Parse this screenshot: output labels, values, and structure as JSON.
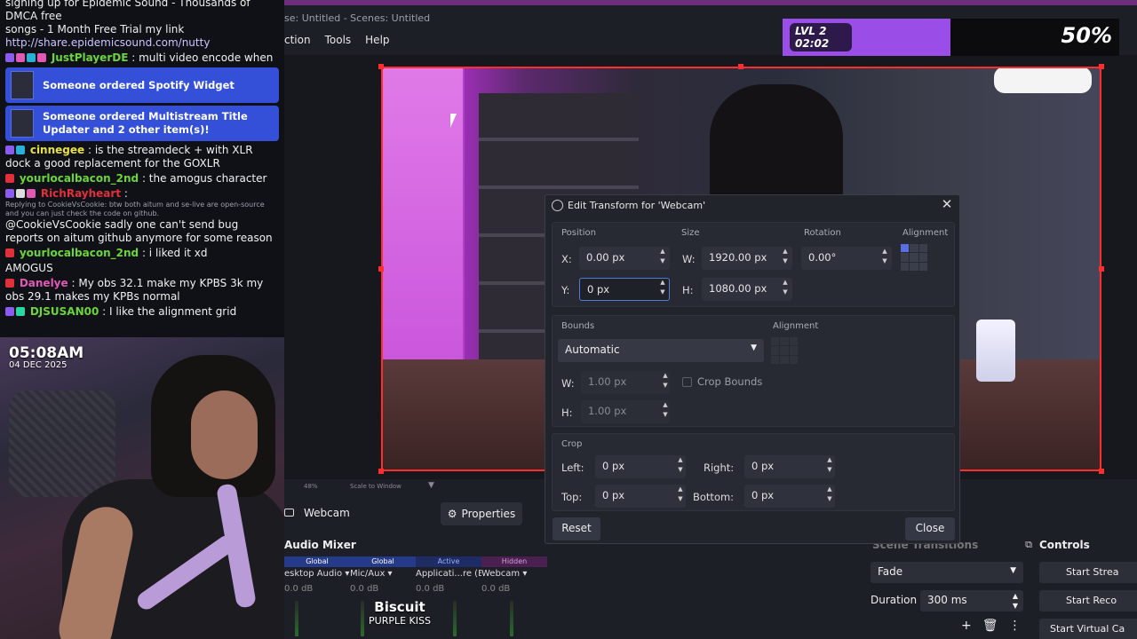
{
  "chat": {
    "top_text_1": "signing up for Epidemic Sound - Thousands of DMCA free",
    "top_text_2": "songs - 1 Month Free Trial my link",
    "top_link": "http://share.epidemicsound.com/nutty",
    "msg1_user": "JustPlayerDE",
    "msg1_text": ": multi video encode when",
    "order1": "Someone ordered Spotify Widget",
    "order2": "Someone ordered Multistream Title Updater and 2 other item(s)!",
    "msg2_user": "cinnegee",
    "msg2_text": ": is the streamdeck + with XLR dock a good replacement for the GOXLR",
    "msg3_user": "yourlocalbacon_2nd",
    "msg3_text": ": the amogus character",
    "msg4_user": "RichRayheart",
    "msg4_text": ":",
    "msg4_reply": "Replying to CookieVsCookie: btw both aitum and se-live are open-source and you can just check the code on github.",
    "msg4_body": "@CookieVsCookie sadly one can't send bug reports on aitum github anymore for some reason",
    "msg5_user": "yourlocalbacon_2nd",
    "msg5_text": ": i liked it xd",
    "msg6_text": "AMOGUS",
    "msg7_user": "Danelye",
    "msg7_text": ": My obs 32.1 make my KPBS 3k my obs 29.1 makes my KPBs normal",
    "msg8_user": "DJSUSAN00",
    "msg8_text": ": I like the alignment grid",
    "colors": {
      "green": "#6ad53c",
      "yellow": "#e8e04a",
      "red": "#e0303a",
      "pink": "#e05ab5",
      "card": "#3450d8"
    }
  },
  "webcam": {
    "time": "05:08AM",
    "date": "04 DEC 2025"
  },
  "obs": {
    "title": "se: Untitled - Scenes: Untitled",
    "menu": [
      "ction",
      "Tools",
      "Help"
    ],
    "zoom": "48%",
    "scale": "Scale to Window",
    "source_name": "Webcam",
    "properties": "Properties",
    "mixer_title": "Audio Mixer",
    "mixer_tags": [
      "Global",
      "Global",
      "Active",
      "Hidden"
    ],
    "mixer_names": [
      "esktop Audio ▾",
      "Mic/Aux ▾",
      "Applicati...re (BETA) ▾",
      "Webcam ▾"
    ],
    "mixer_db": [
      "0.0 dB",
      "0.0 dB",
      "0.0 dB",
      "0.0 dB"
    ],
    "song_title": "Biscuit",
    "song_artist": "PURPLE KISS",
    "transitions_title": "Scene Transitions",
    "transition": "Fade",
    "duration_label": "Duration",
    "duration": "300 ms",
    "controls_title": "Controls",
    "controls": [
      "Start Strea",
      "Start Reco",
      "Start Virtual Ca"
    ]
  },
  "overlay": {
    "lvl": "LVL 2",
    "timer": "02:02",
    "percent": "50%"
  },
  "dialog": {
    "title": "Edit Transform for 'Webcam'",
    "position": "Position",
    "size": "Size",
    "rotation": "Rotation",
    "alignment": "Alignment",
    "x_label": "X:",
    "x_val": "0.00 px",
    "y_label": "Y:",
    "y_val": "0 px",
    "w_label": "W:",
    "w_val": "1920.00 px",
    "h_label": "H:",
    "h_val": "1080.00 px",
    "rot_val": "0.00°",
    "bounds": "Bounds",
    "bounds_alignment": "Alignment",
    "bounds_type": "Automatic",
    "bw_label": "W:",
    "bw_val": "1.00 px",
    "bh_label": "H:",
    "bh_val": "1.00 px",
    "crop_bounds": "Crop Bounds",
    "crop": "Crop",
    "left_label": "Left:",
    "left_val": "0 px",
    "right_label": "Right:",
    "right_val": "0 px",
    "top_label": "Top:",
    "top_val": "0 px",
    "bottom_label": "Bottom:",
    "bottom_val": "0 px",
    "reset": "Reset",
    "close": "Close"
  }
}
